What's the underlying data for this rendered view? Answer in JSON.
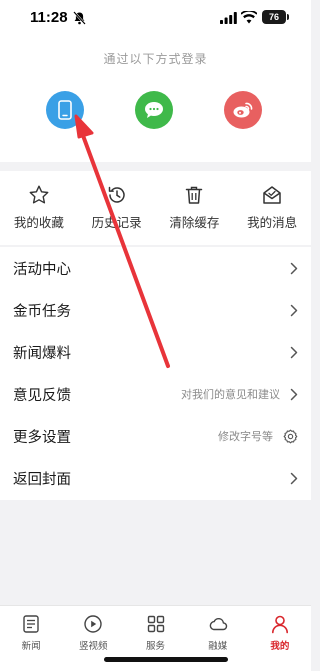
{
  "status_bar": {
    "time": "11:28",
    "battery": "76"
  },
  "login": {
    "title": "通过以下方式登录",
    "options": [
      {
        "icon": "phone-icon",
        "color": "#3aa0e6"
      },
      {
        "icon": "wechat-icon",
        "color": "#3fb94a"
      },
      {
        "icon": "weibo-icon",
        "color": "#e86060"
      }
    ]
  },
  "quick_actions": [
    {
      "label": "我的收藏",
      "icon": "star-icon"
    },
    {
      "label": "历史记录",
      "icon": "history-icon"
    },
    {
      "label": "清除缓存",
      "icon": "trash-icon"
    },
    {
      "label": "我的消息",
      "icon": "message-icon"
    }
  ],
  "menu": [
    {
      "label": "活动中心",
      "hint": "",
      "icon": "chevron-right-icon"
    },
    {
      "label": "金币任务",
      "hint": "",
      "icon": "chevron-right-icon"
    },
    {
      "label": "新闻爆料",
      "hint": "",
      "icon": "chevron-right-icon"
    },
    {
      "label": "意见反馈",
      "hint": "对我们的意见和建议",
      "icon": "chevron-right-icon"
    },
    {
      "label": "更多设置",
      "hint": "修改字号等",
      "icon": "gear-icon"
    },
    {
      "label": "返回封面",
      "hint": "",
      "icon": "chevron-right-icon"
    }
  ],
  "tabs": [
    {
      "label": "新闻",
      "icon": "news-icon",
      "active": false
    },
    {
      "label": "竖视频",
      "icon": "play-icon",
      "active": false
    },
    {
      "label": "服务",
      "icon": "grid-icon",
      "active": false
    },
    {
      "label": "融媒",
      "icon": "cloud-icon",
      "active": false
    },
    {
      "label": "我的",
      "icon": "person-icon",
      "active": true
    }
  ],
  "colors": {
    "accent": "#d9262c",
    "annotation_arrow": "#e8343a"
  }
}
